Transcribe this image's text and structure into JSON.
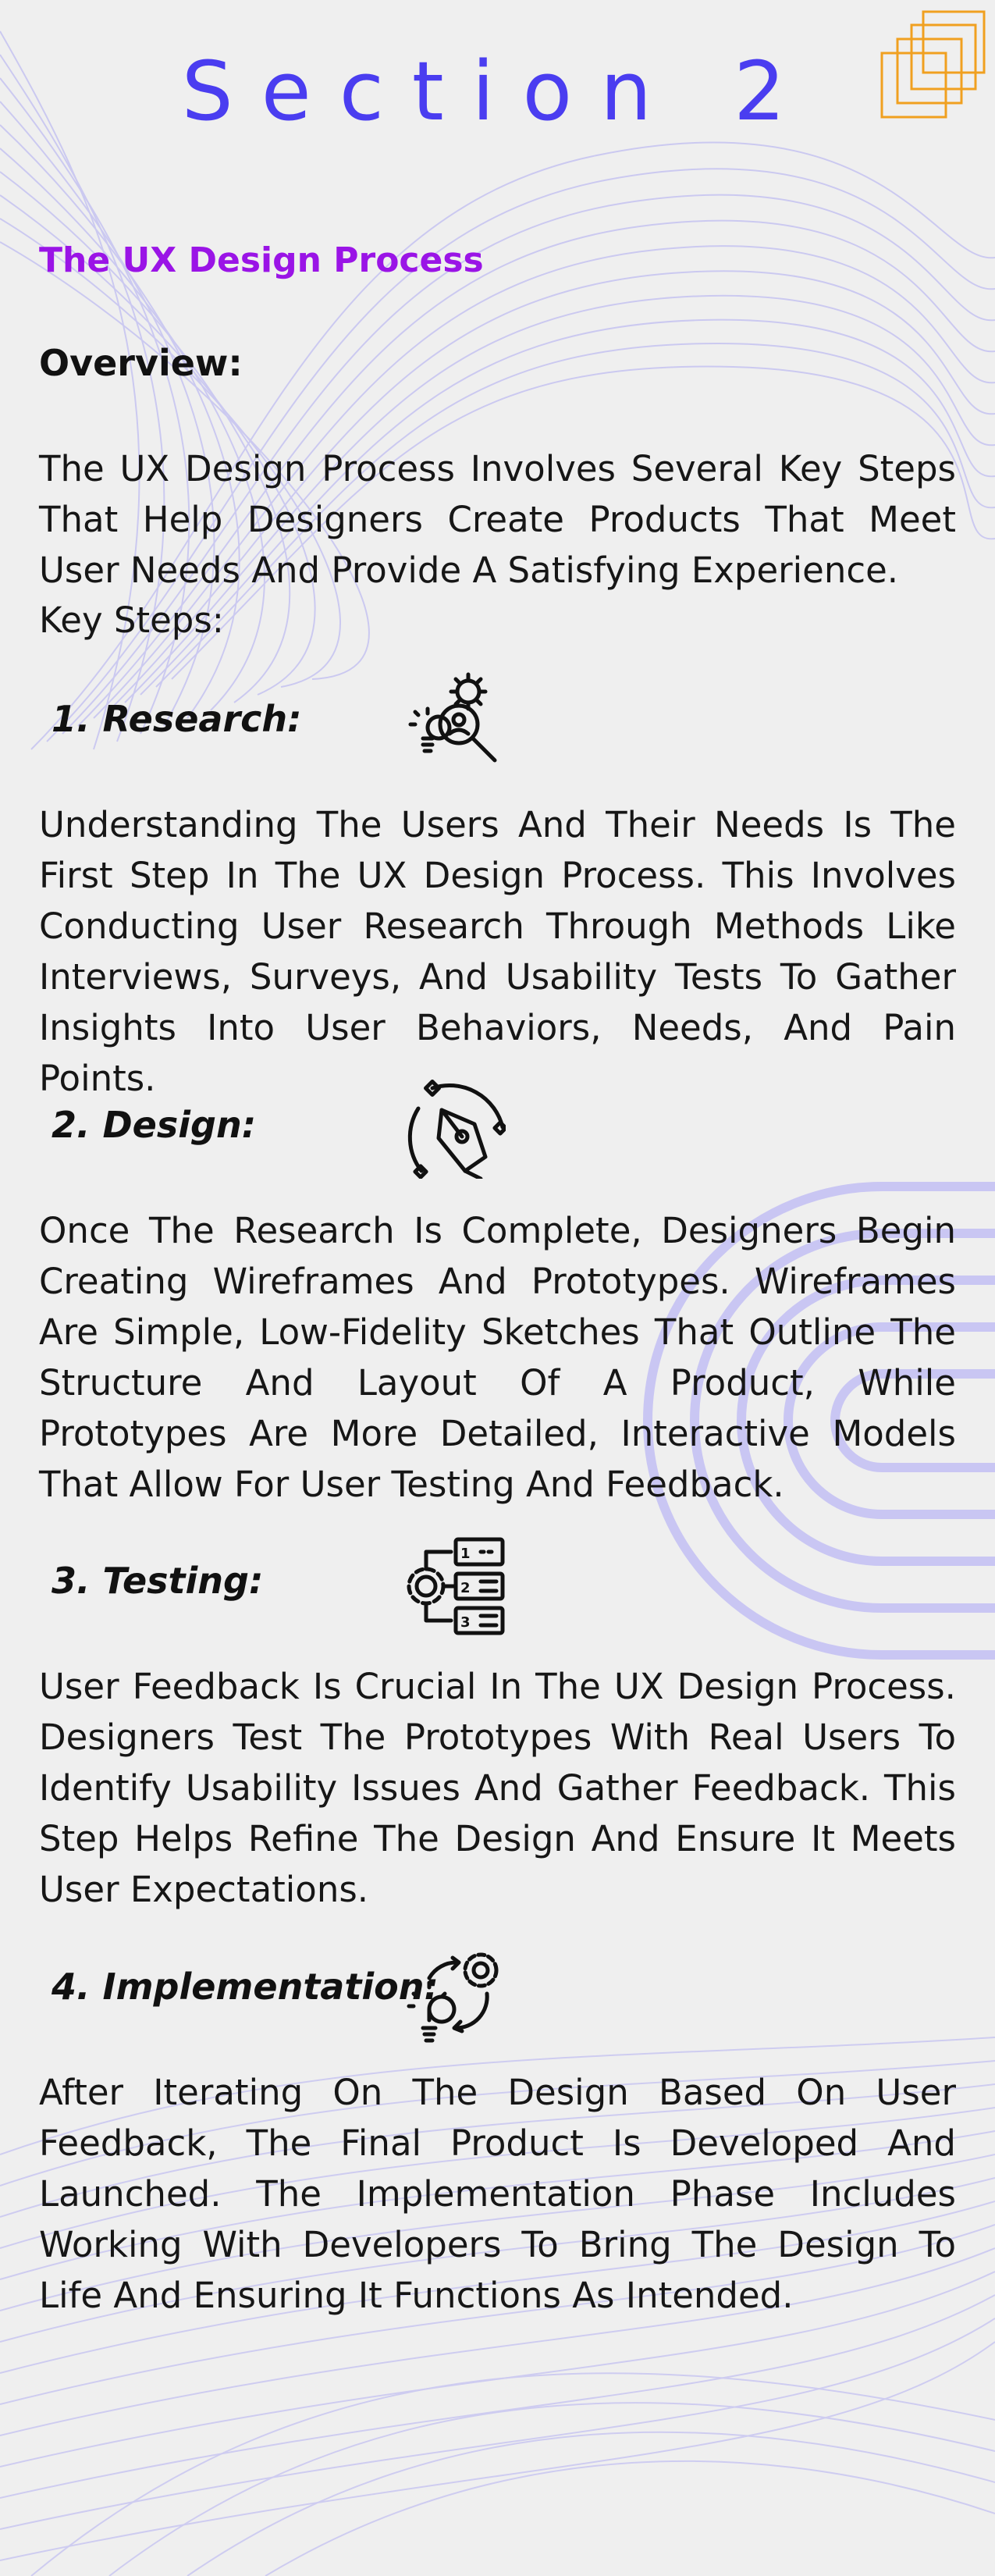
{
  "section_title": "Section 2",
  "main_heading": "The UX Design Process",
  "overview": {
    "heading": "Overview:",
    "text": "The UX Design Process Involves Several Key Steps That Help Designers Create Products That Meet User Needs And Provide A Satisfying Experience.",
    "key_steps_label": "Key Steps:"
  },
  "steps": [
    {
      "heading": "1. Research:",
      "icon": "research-icon",
      "text": "Understanding The Users And Their Needs Is The First Step In The UX Design Process. This Involves Conducting User Research Through Methods Like Interviews, Surveys, And Usability Tests To Gather Insights Into User Behaviors, Needs, And Pain Points."
    },
    {
      "heading": "2. Design:",
      "icon": "pen-tool-icon",
      "text": "Once The Research Is Complete, Designers Begin Creating Wireframes And Prototypes. Wireframes Are Simple, Low-Fidelity Sketches That Outline The Structure And Layout Of A Product, While Prototypes Are More Detailed, Interactive Models That Allow For User Testing And Feedback."
    },
    {
      "heading": "3. Testing:",
      "icon": "checklist-gear-icon",
      "icon_labels": [
        "1",
        "2",
        "3"
      ],
      "text": "User Feedback Is Crucial In The UX Design Process. Designers Test The Prototypes With Real Users To Identify Usability Issues And Gather Feedback. This Step Helps Refine The Design And Ensure It Meets User Expectations."
    },
    {
      "heading": "4. Implementation:",
      "icon": "idea-gear-cycle-icon",
      "text": "After Iterating On The Design Based On User Feedback, The Final Product Is Developed And Launched. The Implementation Phase Includes Working With Developers To Bring The Design To Life And Ensuring It Functions As Intended."
    }
  ],
  "colors": {
    "background": "#efefef",
    "section_title": "#4a3df0",
    "main_heading": "#9a14e6",
    "text": "#161616",
    "decor_lines": "#b9b6f2",
    "decor_arc": "#c9c6f3",
    "corner_logo": "#f0a020"
  }
}
